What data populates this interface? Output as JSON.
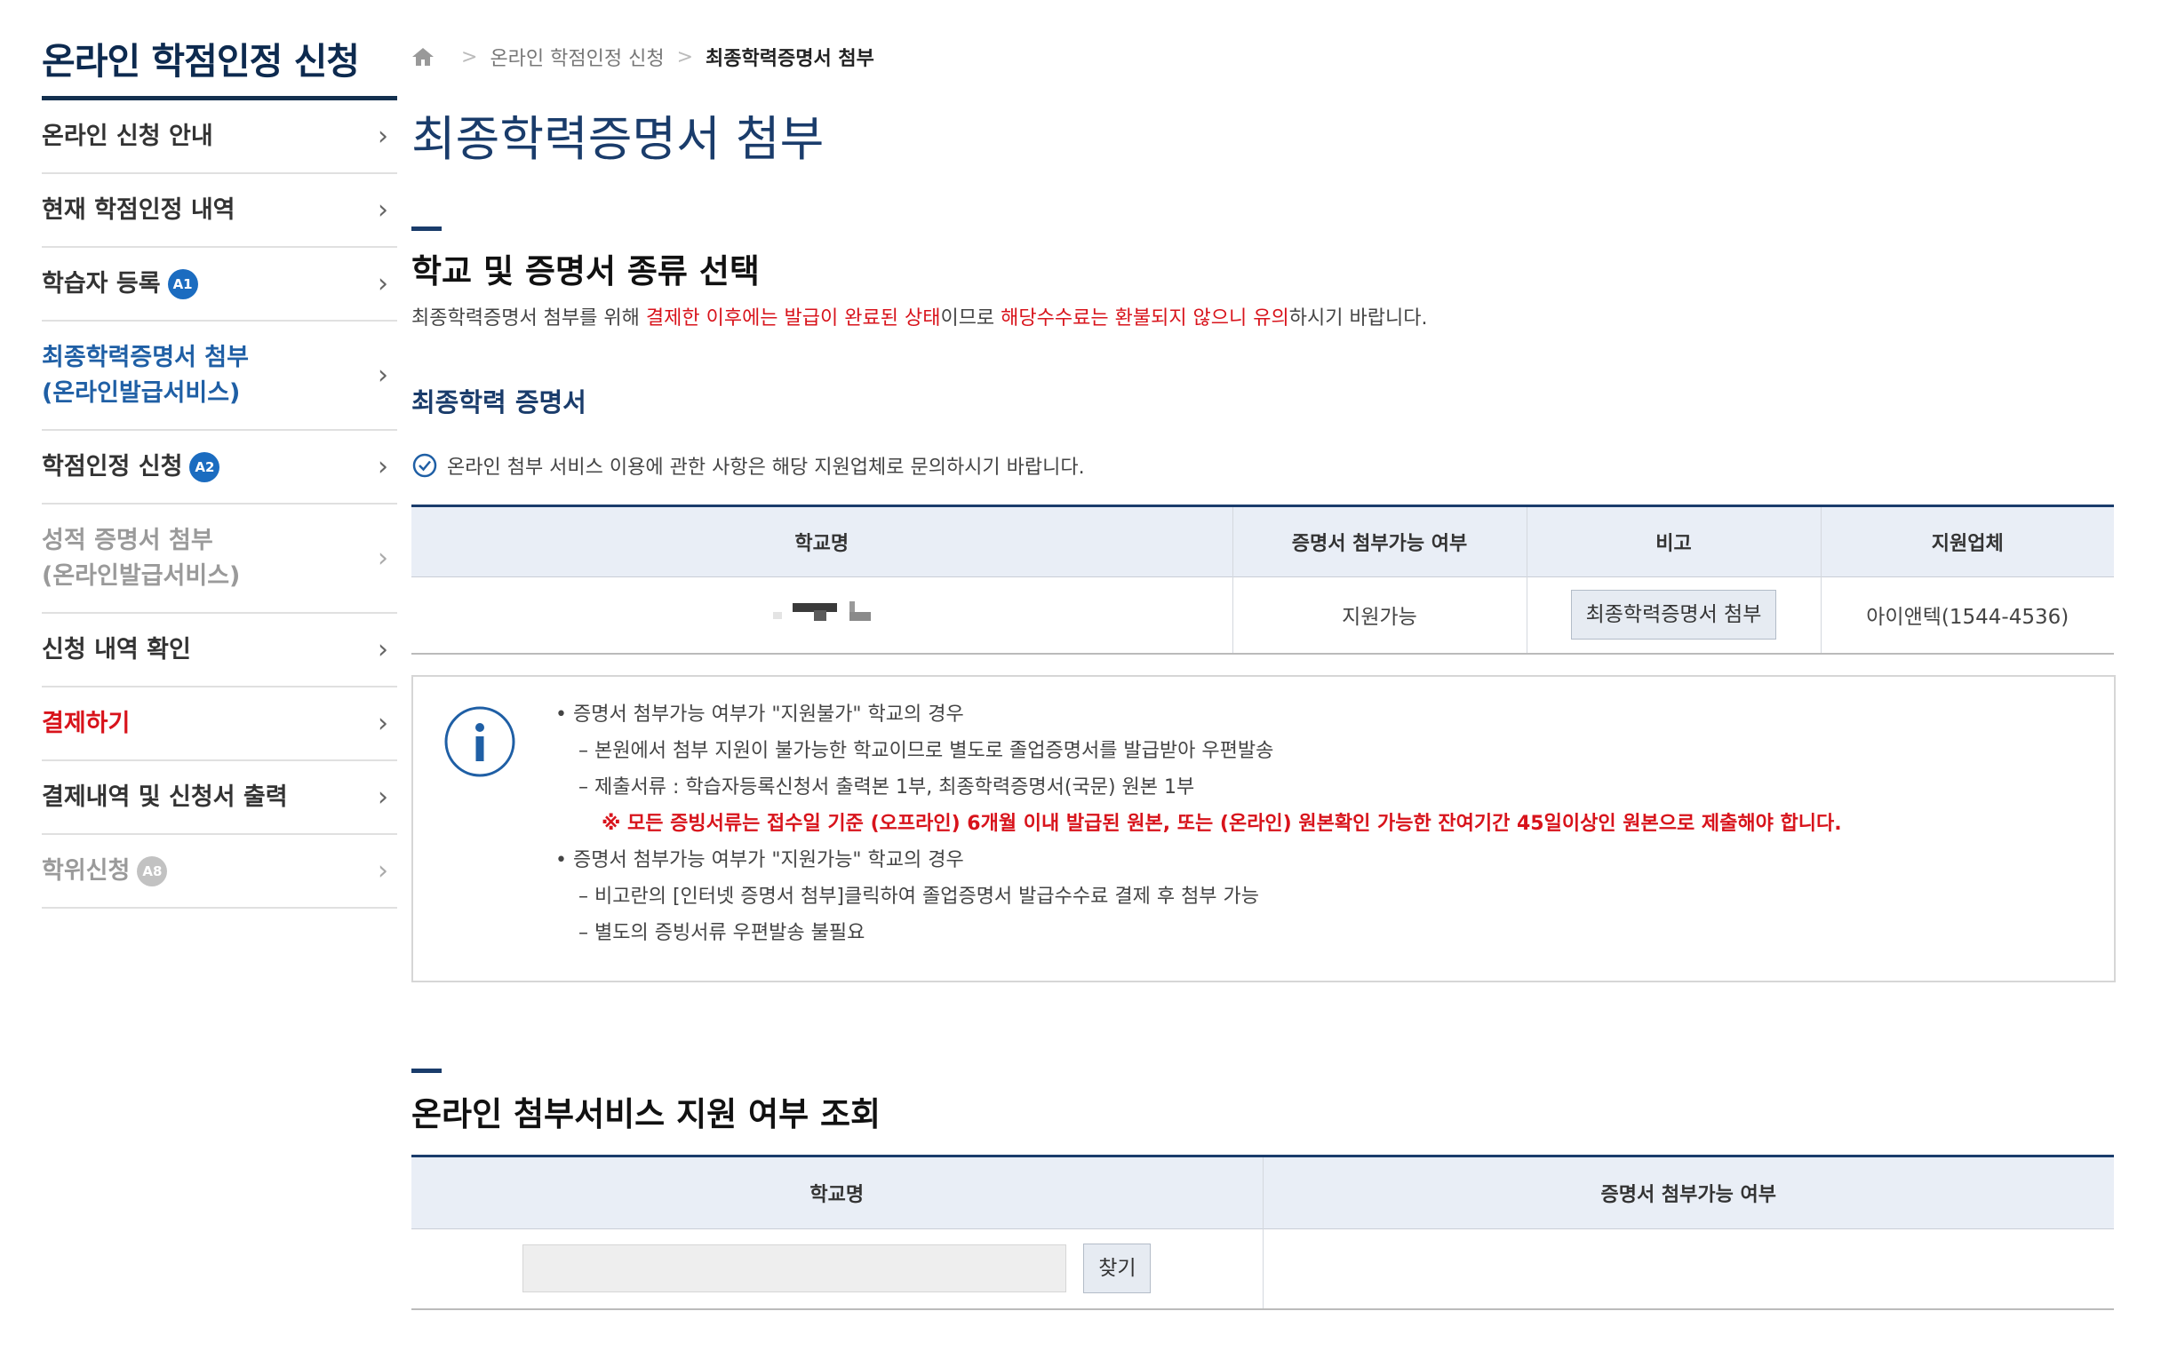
{
  "sidebar": {
    "title": "온라인 학점인정 신청",
    "items": [
      {
        "label": "온라인 신청 안내"
      },
      {
        "label": "현재 학점인정 내역"
      },
      {
        "label": "학습자 등록",
        "badge": "A1"
      },
      {
        "label_line1": "최종학력증명서 첨부",
        "label_line2": "(온라인발급서비스)"
      },
      {
        "label": "학점인정 신청",
        "badge": "A2"
      },
      {
        "label_line1": "성적 증명서 첨부",
        "label_line2": "(온라인발급서비스)"
      },
      {
        "label": "신청 내역 확인"
      },
      {
        "label": "결제하기"
      },
      {
        "label": "결제내역 및 신청서 출력"
      },
      {
        "label": "학위신청",
        "badge": "A8"
      }
    ],
    "chevron": "›"
  },
  "breadcrumb": {
    "home_icon": "home-icon",
    "separator": ">",
    "parent": "온라인 학점인정 신청",
    "current": "최종학력증명서 첨부"
  },
  "page_title": "최종학력증명서 첨부",
  "section1": {
    "title": "학교 및 증명서 종류 선택",
    "desc_1": "최종학력증명서 첨부를 위해 ",
    "desc_red_1": "결제한 이후에는 발급이 완료된 상태",
    "desc_2": "이므로 ",
    "desc_red_2": "해당수수료는 환불되지 않으니 유의",
    "desc_3": "하시기 바랍니다.",
    "subtitle": "최종학력 증명서",
    "check_note": "온라인 첨부 서비스 이용에 관한 사항은 해당 지원업체로 문의하시기 바랍니다.",
    "table": {
      "headers": [
        "학교명",
        "증명서 첨부가능 여부",
        "비고",
        "지원업체"
      ],
      "row": {
        "availability": "지원가능",
        "action_button": "최종학력증명서 첨부",
        "vendor": "아이앤텍(1544-4536)"
      }
    },
    "info": {
      "icon": "info-icon",
      "lines": [
        "•  증명서 첨부가능 여부가 \"지원불가\" 학교의 경우",
        "–  본원에서 첨부 지원이 불가능한 학교이므로 별도로 졸업증명서를 발급받아 우편발송",
        "–  제출서류 : 학습자등록신청서 출력본 1부, 최종학력증명서(국문) 원본 1부",
        "※ 모든 증빙서류는 접수일 기준 (오프라인) 6개월 이내 발급된 원본, 또는 (온라인) 원본확인 가능한 잔여기간 45일이상인 원본으로 제출해야 합니다.",
        "•  증명서 첨부가능 여부가 \"지원가능\" 학교의 경우",
        "–  비고란의 [인터넷 증명서 첨부]클릭하여 졸업증명서 발급수수료 결제 후 첨부 가능",
        "–  별도의 증빙서류 우편발송 불필요"
      ]
    }
  },
  "section2": {
    "title": "온라인 첨부서비스 지원 여부 조회",
    "table": {
      "headers": [
        "학교명",
        "증명서 첨부가능 여부"
      ],
      "search_value": "",
      "find_button": "찾기"
    }
  },
  "colors": {
    "navy": "#1a3c6b",
    "active_blue": "#1f5fa5",
    "red": "#d8131b",
    "table_header_bg": "#e9eef6"
  }
}
